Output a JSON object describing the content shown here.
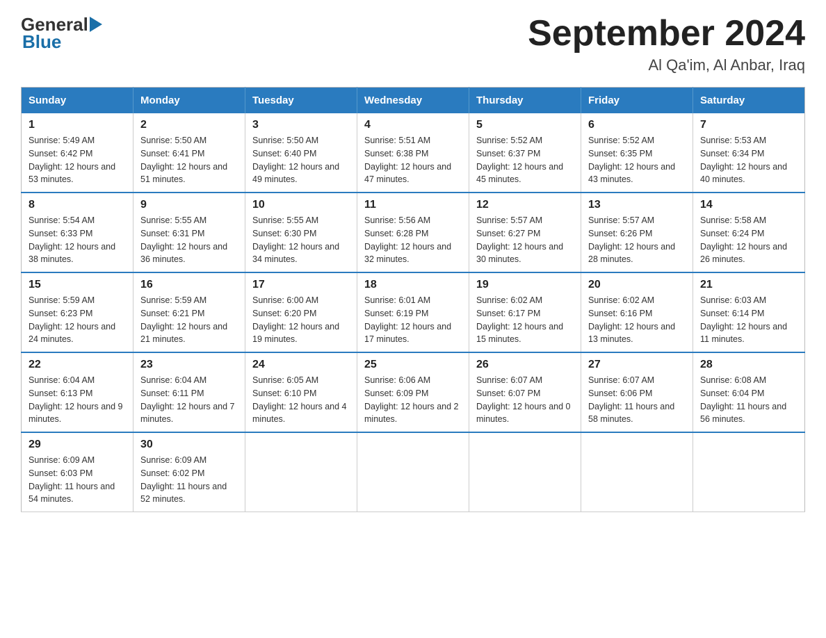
{
  "header": {
    "logo_general": "General",
    "logo_blue": "Blue",
    "month_title": "September 2024",
    "location": "Al Qa'im, Al Anbar, Iraq"
  },
  "weekdays": [
    "Sunday",
    "Monday",
    "Tuesday",
    "Wednesday",
    "Thursday",
    "Friday",
    "Saturday"
  ],
  "weeks": [
    [
      {
        "day": "1",
        "sunrise": "5:49 AM",
        "sunset": "6:42 PM",
        "daylight": "12 hours and 53 minutes."
      },
      {
        "day": "2",
        "sunrise": "5:50 AM",
        "sunset": "6:41 PM",
        "daylight": "12 hours and 51 minutes."
      },
      {
        "day": "3",
        "sunrise": "5:50 AM",
        "sunset": "6:40 PM",
        "daylight": "12 hours and 49 minutes."
      },
      {
        "day": "4",
        "sunrise": "5:51 AM",
        "sunset": "6:38 PM",
        "daylight": "12 hours and 47 minutes."
      },
      {
        "day": "5",
        "sunrise": "5:52 AM",
        "sunset": "6:37 PM",
        "daylight": "12 hours and 45 minutes."
      },
      {
        "day": "6",
        "sunrise": "5:52 AM",
        "sunset": "6:35 PM",
        "daylight": "12 hours and 43 minutes."
      },
      {
        "day": "7",
        "sunrise": "5:53 AM",
        "sunset": "6:34 PM",
        "daylight": "12 hours and 40 minutes."
      }
    ],
    [
      {
        "day": "8",
        "sunrise": "5:54 AM",
        "sunset": "6:33 PM",
        "daylight": "12 hours and 38 minutes."
      },
      {
        "day": "9",
        "sunrise": "5:55 AM",
        "sunset": "6:31 PM",
        "daylight": "12 hours and 36 minutes."
      },
      {
        "day": "10",
        "sunrise": "5:55 AM",
        "sunset": "6:30 PM",
        "daylight": "12 hours and 34 minutes."
      },
      {
        "day": "11",
        "sunrise": "5:56 AM",
        "sunset": "6:28 PM",
        "daylight": "12 hours and 32 minutes."
      },
      {
        "day": "12",
        "sunrise": "5:57 AM",
        "sunset": "6:27 PM",
        "daylight": "12 hours and 30 minutes."
      },
      {
        "day": "13",
        "sunrise": "5:57 AM",
        "sunset": "6:26 PM",
        "daylight": "12 hours and 28 minutes."
      },
      {
        "day": "14",
        "sunrise": "5:58 AM",
        "sunset": "6:24 PM",
        "daylight": "12 hours and 26 minutes."
      }
    ],
    [
      {
        "day": "15",
        "sunrise": "5:59 AM",
        "sunset": "6:23 PM",
        "daylight": "12 hours and 24 minutes."
      },
      {
        "day": "16",
        "sunrise": "5:59 AM",
        "sunset": "6:21 PM",
        "daylight": "12 hours and 21 minutes."
      },
      {
        "day": "17",
        "sunrise": "6:00 AM",
        "sunset": "6:20 PM",
        "daylight": "12 hours and 19 minutes."
      },
      {
        "day": "18",
        "sunrise": "6:01 AM",
        "sunset": "6:19 PM",
        "daylight": "12 hours and 17 minutes."
      },
      {
        "day": "19",
        "sunrise": "6:02 AM",
        "sunset": "6:17 PM",
        "daylight": "12 hours and 15 minutes."
      },
      {
        "day": "20",
        "sunrise": "6:02 AM",
        "sunset": "6:16 PM",
        "daylight": "12 hours and 13 minutes."
      },
      {
        "day": "21",
        "sunrise": "6:03 AM",
        "sunset": "6:14 PM",
        "daylight": "12 hours and 11 minutes."
      }
    ],
    [
      {
        "day": "22",
        "sunrise": "6:04 AM",
        "sunset": "6:13 PM",
        "daylight": "12 hours and 9 minutes."
      },
      {
        "day": "23",
        "sunrise": "6:04 AM",
        "sunset": "6:11 PM",
        "daylight": "12 hours and 7 minutes."
      },
      {
        "day": "24",
        "sunrise": "6:05 AM",
        "sunset": "6:10 PM",
        "daylight": "12 hours and 4 minutes."
      },
      {
        "day": "25",
        "sunrise": "6:06 AM",
        "sunset": "6:09 PM",
        "daylight": "12 hours and 2 minutes."
      },
      {
        "day": "26",
        "sunrise": "6:07 AM",
        "sunset": "6:07 PM",
        "daylight": "12 hours and 0 minutes."
      },
      {
        "day": "27",
        "sunrise": "6:07 AM",
        "sunset": "6:06 PM",
        "daylight": "11 hours and 58 minutes."
      },
      {
        "day": "28",
        "sunrise": "6:08 AM",
        "sunset": "6:04 PM",
        "daylight": "11 hours and 56 minutes."
      }
    ],
    [
      {
        "day": "29",
        "sunrise": "6:09 AM",
        "sunset": "6:03 PM",
        "daylight": "11 hours and 54 minutes."
      },
      {
        "day": "30",
        "sunrise": "6:09 AM",
        "sunset": "6:02 PM",
        "daylight": "11 hours and 52 minutes."
      },
      null,
      null,
      null,
      null,
      null
    ]
  ]
}
